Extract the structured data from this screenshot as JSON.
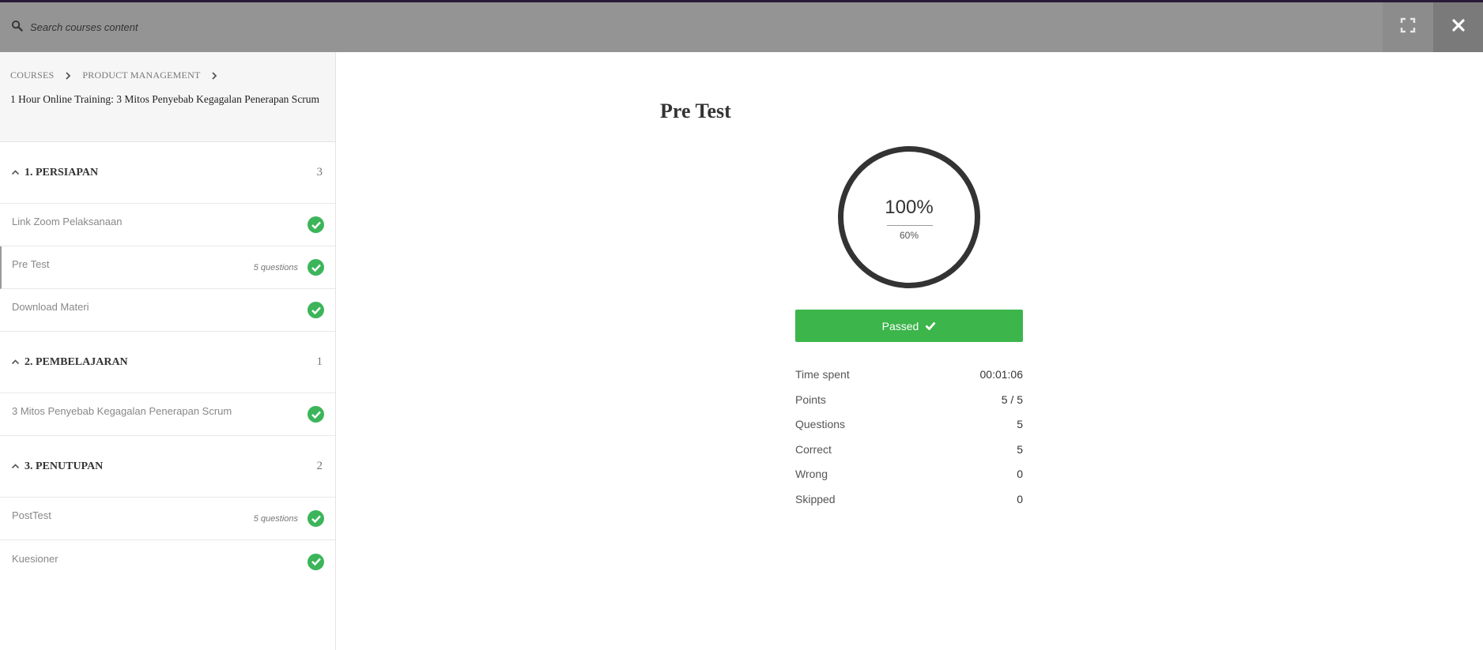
{
  "search": {
    "placeholder": "Search courses content"
  },
  "breadcrumb": [
    "COURSES",
    "PRODUCT MANAGEMENT"
  ],
  "course_title": "1 Hour Online Training: 3 Mitos Penyebab Kegagalan Penerapan Scrum",
  "sections": [
    {
      "title": "1. PERSIAPAN",
      "count": "3",
      "items": [
        {
          "title": "Link Zoom Pelaksanaan",
          "meta": ""
        },
        {
          "title": "Pre Test",
          "meta": "5 questions"
        },
        {
          "title": "Download Materi",
          "meta": ""
        }
      ]
    },
    {
      "title": "2. PEMBELAJARAN",
      "count": "1",
      "items": [
        {
          "title": "3 Mitos Penyebab Kegagalan Penerapan Scrum",
          "meta": ""
        }
      ]
    },
    {
      "title": "3. PENUTUPAN",
      "count": "2",
      "items": [
        {
          "title": "PostTest",
          "meta": "5 questions"
        },
        {
          "title": "Kuesioner",
          "meta": ""
        }
      ]
    }
  ],
  "quiz": {
    "title": "Pre Test",
    "score": "100%",
    "passing": "60%",
    "result_label": "Passed",
    "stats": [
      {
        "label": "Time spent",
        "value": "00:01:06"
      },
      {
        "label": "Points",
        "value": "5 / 5"
      },
      {
        "label": "Questions",
        "value": "5"
      },
      {
        "label": "Correct",
        "value": "5"
      },
      {
        "label": "Wrong",
        "value": "0"
      },
      {
        "label": "Skipped",
        "value": "0"
      }
    ]
  },
  "colors": {
    "passed": "#3cb54a",
    "check": "#3cb55a",
    "topbar": "#949494"
  },
  "icons": {
    "search": "search-icon",
    "expand": "fullscreen-icon",
    "close": "close-icon",
    "check": "check-circle-icon"
  }
}
